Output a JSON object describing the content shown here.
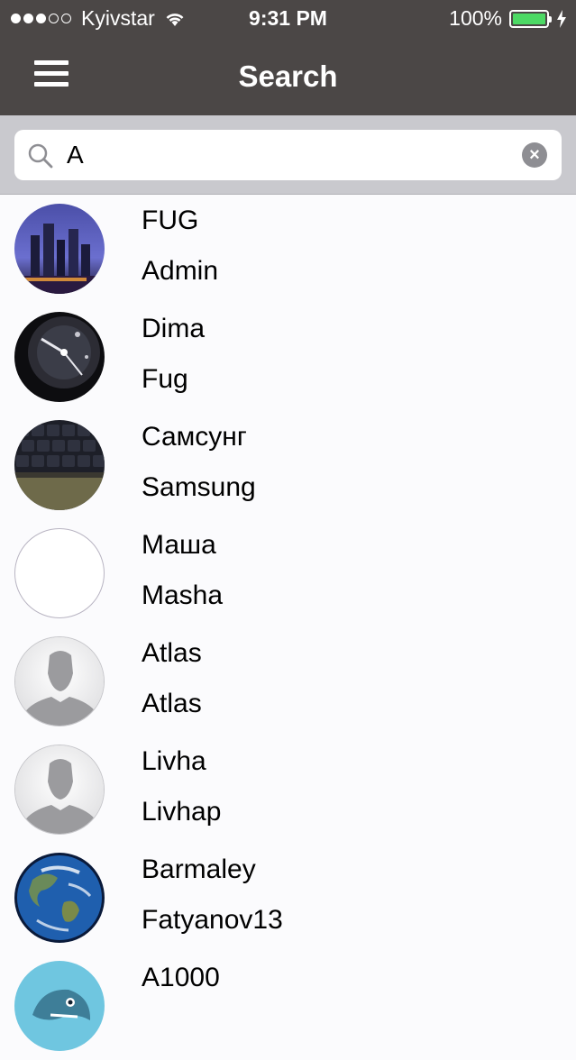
{
  "status_bar": {
    "carrier": "Kyivstar",
    "time": "9:31 PM",
    "battery": "100%"
  },
  "nav": {
    "title": "Search"
  },
  "search": {
    "value": "A",
    "clear_label": "×"
  },
  "results": [
    {
      "name": "FUG",
      "username": "Admin",
      "avatar": "city-skyline"
    },
    {
      "name": "Dima",
      "username": "Fug",
      "avatar": "watch"
    },
    {
      "name": "Самсунг",
      "username": "Samsung",
      "avatar": "keyboard"
    },
    {
      "name": "Маша",
      "username": "Masha",
      "avatar": "blank"
    },
    {
      "name": "Atlas",
      "username": "Atlas",
      "avatar": "default-person"
    },
    {
      "name": "Livha",
      "username": "Livhap",
      "avatar": "default-person"
    },
    {
      "name": "Barmaley",
      "username": "Fatyanov13",
      "avatar": "earth"
    },
    {
      "name": "A1000",
      "username": "",
      "avatar": "shark"
    }
  ]
}
